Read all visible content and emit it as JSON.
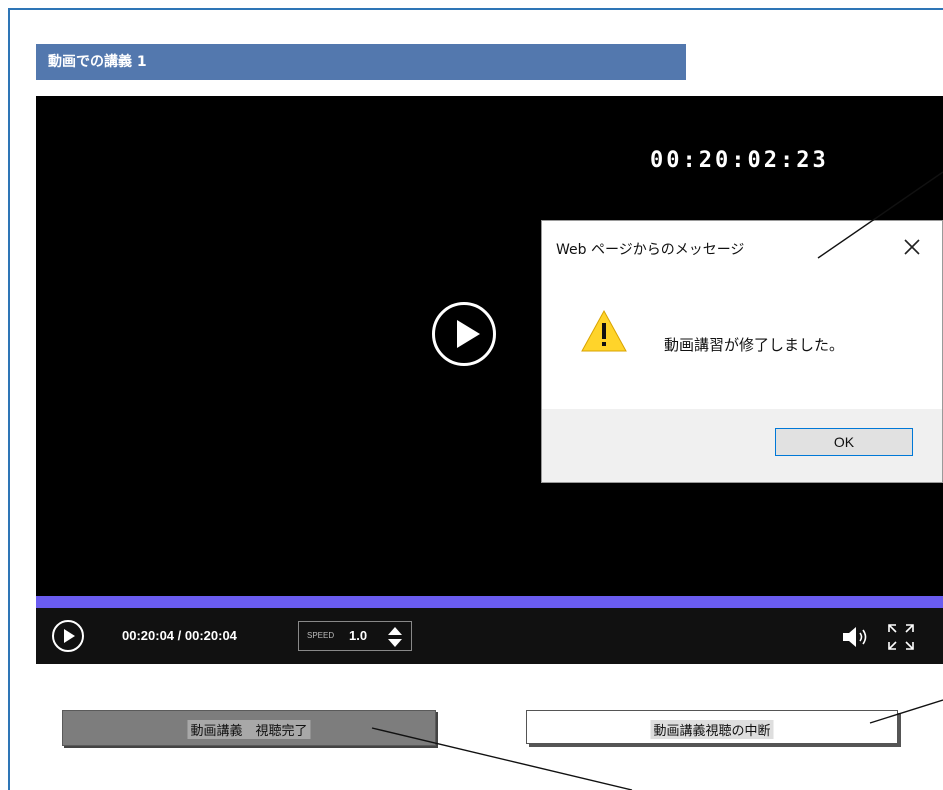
{
  "section": {
    "title": "動画での講義 1"
  },
  "video": {
    "overlay_timecode": "00:20:02:23",
    "progress_fraction": 1.0,
    "time_display": "00:20:04 / 00:20:04",
    "speed_label": "SPEED",
    "speed_value": "1.0"
  },
  "dialog": {
    "title": "Web ページからのメッセージ",
    "close_glyph": "✕",
    "message": "動画講習が修了しました。",
    "ok_label": "OK"
  },
  "buttons": {
    "complete_label": "動画講義　視聴完了",
    "suspend_label": "動画講義視聴の中断"
  },
  "colors": {
    "header_bg": "#5378ae",
    "progress": "#6a5cf0",
    "frame_border": "#2e75b6"
  }
}
